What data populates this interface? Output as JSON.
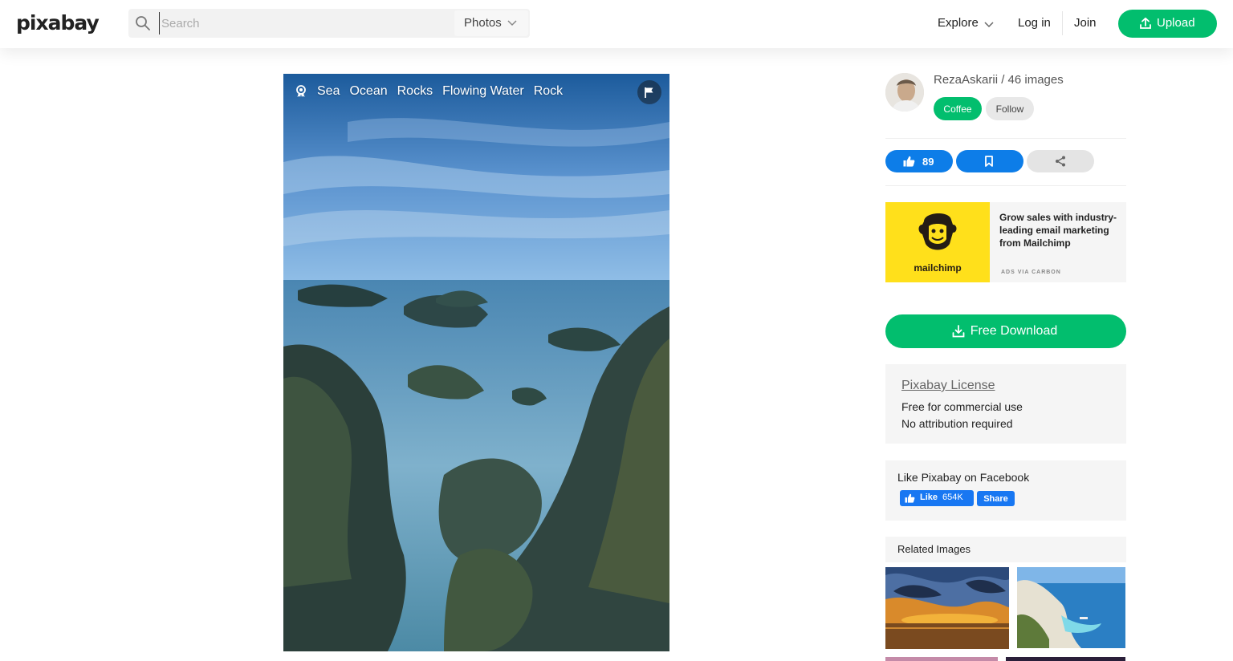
{
  "header": {
    "logo": "pixabay",
    "search_placeholder": "Search",
    "media_type": "Photos",
    "explore_label": "Explore",
    "login_label": "Log in",
    "join_label": "Join",
    "upload_label": "Upload"
  },
  "photo": {
    "tags": [
      "Sea",
      "Ocean",
      "Rocks",
      "Flowing Water",
      "Rock"
    ]
  },
  "author": {
    "name_line": "RezaAskarii / 46 images",
    "coffee_label": "Coffee",
    "follow_label": "Follow"
  },
  "actions": {
    "like_count": "89"
  },
  "ad": {
    "brand": "mailchimp",
    "text": "Grow sales with industry-leading email marketing from Mailchimp",
    "via": "ADS VIA CARBON"
  },
  "download": {
    "label": "Free Download"
  },
  "license": {
    "title": "Pixabay License",
    "lines": [
      "Free for commercial use",
      "No attribution required"
    ]
  },
  "facebook": {
    "title": "Like Pixabay on Facebook",
    "like_label": "Like",
    "like_count": "654K",
    "share_label": "Share"
  },
  "related": {
    "title": "Related Images"
  },
  "colors": {
    "brand_green": "#02be6e",
    "action_blue": "#0d7de8",
    "facebook_blue": "#1877f2",
    "ad_yellow": "#ffe01b"
  }
}
